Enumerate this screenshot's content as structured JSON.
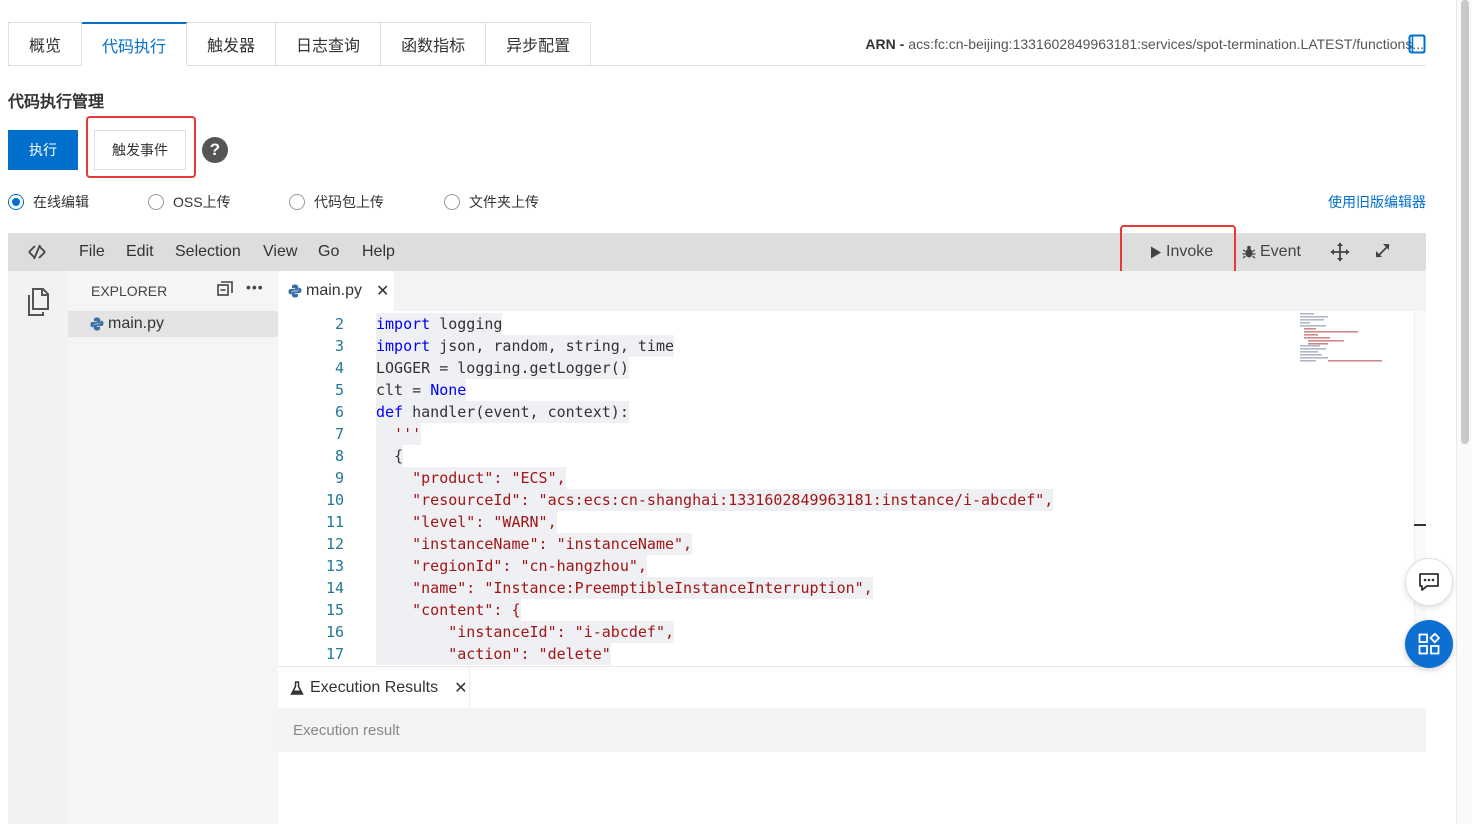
{
  "tabs": [
    {
      "label": "概览",
      "active": false
    },
    {
      "label": "代码执行",
      "active": true
    },
    {
      "label": "触发器",
      "active": false
    },
    {
      "label": "日志查询",
      "active": false
    },
    {
      "label": "函数指标",
      "active": false
    },
    {
      "label": "异步配置",
      "active": false
    }
  ],
  "arn": {
    "label": "ARN -",
    "value": "acs:fc:cn-beijing:1331602849963181:services/spot-termination.LATEST/functions..."
  },
  "section": {
    "title": "代码执行管理",
    "execute_label": "执行",
    "trigger_event_label": "触发事件"
  },
  "upload_options": {
    "items": [
      {
        "label": "在线编辑",
        "selected": true
      },
      {
        "label": "OSS上传",
        "selected": false
      },
      {
        "label": "代码包上传",
        "selected": false
      },
      {
        "label": "文件夹上传",
        "selected": false
      }
    ],
    "old_editor_link": "使用旧版编辑器"
  },
  "ide": {
    "menu": [
      "File",
      "Edit",
      "Selection",
      "View",
      "Go",
      "Help"
    ],
    "invoke_label": "Invoke",
    "event_label": "Event",
    "explorer_title": "EXPLORER",
    "explorer_file": "main.py",
    "editor_tab": "main.py",
    "panel_tab": "Execution Results",
    "panel_placeholder": "Execution result"
  },
  "code_lines": [
    {
      "n": "2",
      "parts": [
        [
          "kw",
          "import"
        ],
        [
          "",
          "logging"
        ]
      ]
    },
    {
      "n": "3",
      "parts": [
        [
          "kw",
          "import"
        ],
        [
          "",
          "json, random, string, time"
        ]
      ]
    },
    {
      "n": "4",
      "parts": [
        [
          "",
          "LOGGER = logging.getLogger()"
        ]
      ]
    },
    {
      "n": "5",
      "parts": [
        [
          "",
          "clt = "
        ],
        [
          "kw",
          "None"
        ]
      ]
    },
    {
      "n": "6",
      "parts": [
        [
          "kw",
          "def"
        ],
        [
          "",
          "handler(event, context):"
        ]
      ]
    },
    {
      "n": "7",
      "parts": [
        [
          "str",
          "  '''"
        ]
      ]
    },
    {
      "n": "8",
      "parts": [
        [
          "",
          "  {"
        ]
      ]
    },
    {
      "n": "9",
      "parts": [
        [
          "str",
          "    \"product\": \"ECS\","
        ]
      ]
    },
    {
      "n": "10",
      "parts": [
        [
          "str",
          "    \"resourceId\": \"acs:ecs:cn-shanghai:1331602849963181:instance/i-abcdef\","
        ]
      ]
    },
    {
      "n": "11",
      "parts": [
        [
          "str",
          "    \"level\": \"WARN\","
        ]
      ]
    },
    {
      "n": "12",
      "parts": [
        [
          "str",
          "    \"instanceName\": \"instanceName\","
        ]
      ]
    },
    {
      "n": "13",
      "parts": [
        [
          "str",
          "    \"regionId\": \"cn-hangzhou\","
        ]
      ]
    },
    {
      "n": "14",
      "parts": [
        [
          "str",
          "    \"name\": \"Instance:PreemptibleInstanceInterruption\","
        ]
      ]
    },
    {
      "n": "15",
      "parts": [
        [
          "str",
          "    \"content\": {"
        ]
      ]
    },
    {
      "n": "16",
      "parts": [
        [
          "str",
          "        \"instanceId\": \"i-abcdef\","
        ]
      ]
    },
    {
      "n": "17",
      "parts": [
        [
          "str",
          "        \"action\": \"delete\""
        ]
      ]
    }
  ],
  "colors": {
    "accent": "#0070cc",
    "highlight_box": "#e53935",
    "keyword": "#0000ff",
    "string": "#a31515",
    "line_number": "#237893"
  }
}
